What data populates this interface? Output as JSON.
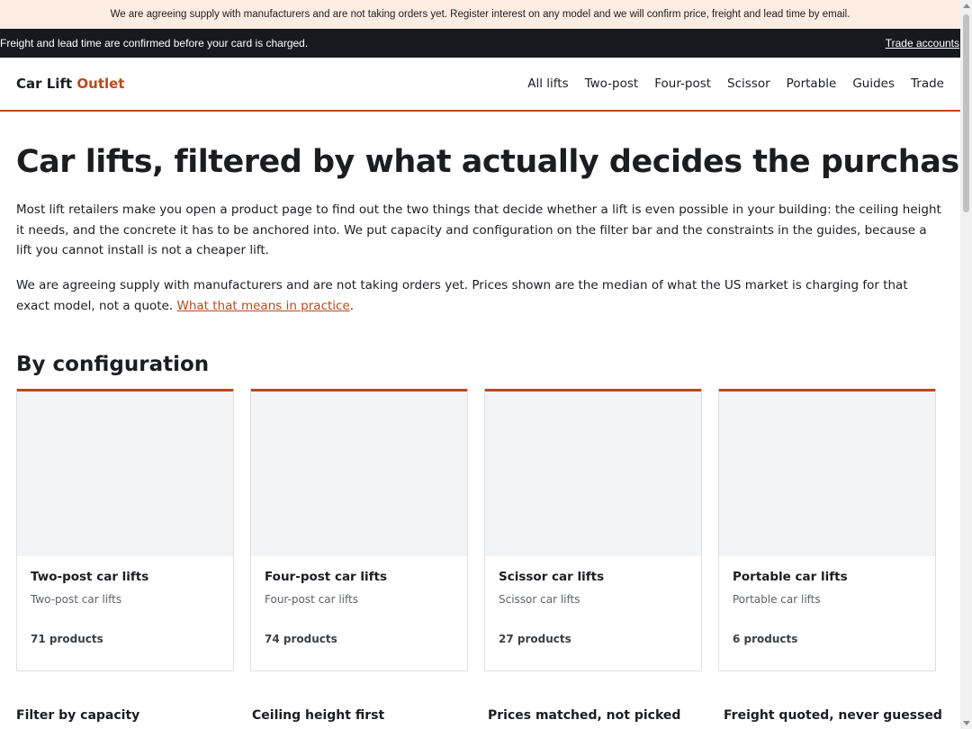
{
  "notice": {
    "text": "We are agreeing supply with manufacturers and are not taking orders yet. Register interest on any model and we will confirm price, freight and lead time by email."
  },
  "topbar": {
    "left_text": "Freight and lead time are confirmed before your card is charged.",
    "trade_link": "Trade accounts"
  },
  "header": {
    "logo_main": "Car Lift",
    "logo_accent": "Outlet",
    "nav": [
      "All lifts",
      "Two-post",
      "Four-post",
      "Scissor",
      "Portable",
      "Guides",
      "Trade"
    ]
  },
  "hero": {
    "title": "Car lifts, filtered by what actually decides the purchase",
    "para1": "Most lift retailers make you open a product page to find out the two things that decide whether a lift is even possible in your building: the ceiling height it needs, and the concrete it has to be anchored into. We put capacity and configuration on the filter bar and the constraints in the guides, because a lift you cannot install is not a cheaper lift.",
    "para2_text": "We are agreeing supply with manufacturers and are not taking orders yet. Prices shown are the median of what the US market is charging for that exact model, not a quote.",
    "para2_link": "What that means in practice",
    "para2_end": "."
  },
  "section": {
    "heading": "By configuration"
  },
  "cards": [
    {
      "title": "Two-post car lifts",
      "subtitle": "Two-post car lifts",
      "count": "71 products"
    },
    {
      "title": "Four-post car lifts",
      "subtitle": "Four-post car lifts",
      "count": "74 products"
    },
    {
      "title": "Scissor car lifts",
      "subtitle": "Scissor car lifts",
      "count": "27 products"
    },
    {
      "title": "Portable car lifts",
      "subtitle": "Portable car lifts",
      "count": "6 products"
    }
  ],
  "features": [
    "Filter by capacity",
    "Ceiling height first",
    "Prices matched, not picked",
    "Freight quoted, never guessed"
  ],
  "colors": {
    "accent": "#b84a1c",
    "notice_bg": "#fdece2",
    "dark_bar": "#161a1f",
    "card_image_bg": "#f3f4f6"
  }
}
